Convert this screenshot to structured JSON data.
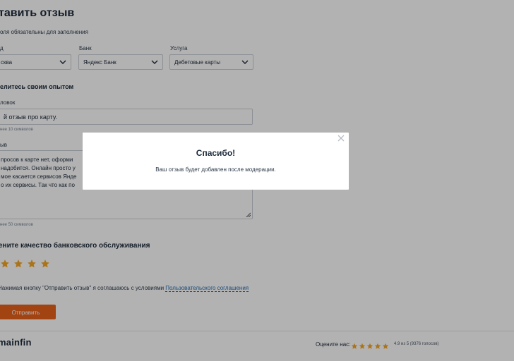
{
  "form": {
    "title": "тавить отзыв",
    "required_note": "оля обязательны для заполнения",
    "city_label": "д",
    "city_value": "сква",
    "bank_label": "Банк",
    "bank_value": "Яндекс Банк",
    "service_label": "Услуга",
    "service_value": "Дебетовые карты",
    "experience_heading": "елитесь своим опытом",
    "headline_label": "ловок",
    "headline_value": "й отзыв про карту.",
    "headline_hint": "нее 10 символов",
    "review_label": "ыв",
    "review_lines": [
      "просов к карте нет, оформи",
      "надобится. Онлайн просто у",
      "мое касается сервисов Янде",
      "о их сервисы. Так что как по"
    ],
    "review_hint": "нее 50 символов",
    "rating_heading": "ените качество банковского обслуживания",
    "rating_value": 5,
    "agree_text": "Нажимая кнопку \"Отправить отзыв\" я соглашаюсь с условиями ",
    "agree_link": "Пользовательского соглашения",
    "submit_label": "Отправить"
  },
  "footer": {
    "logo": "mainfin",
    "rate_us_label": "Оцените нас:",
    "score_text": "4.9 из 5 (9376 голосов)"
  },
  "modal": {
    "title": "Спасибо!",
    "message": "Ваш отзыв будет добавлен после модерации."
  },
  "colors": {
    "accent": "#e8611a",
    "star": "#f5a623",
    "link": "#2a6fb0",
    "overlay": "rgba(0,0,0,0.3)"
  },
  "icons": {
    "select_chevron": "chevron-down-icon",
    "rating_star": "star-icon",
    "modal_close": "close-icon",
    "textarea_resize": "resize-handle-icon"
  }
}
